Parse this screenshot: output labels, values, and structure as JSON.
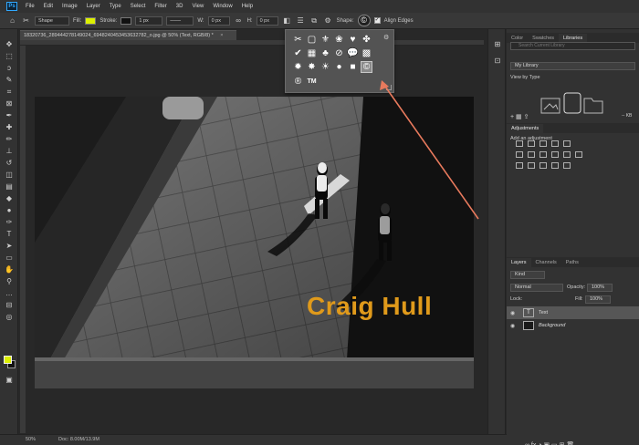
{
  "menu": {
    "items": [
      "File",
      "Edit",
      "Image",
      "Layer",
      "Type",
      "Select",
      "Filter",
      "3D",
      "View",
      "Window",
      "Help"
    ]
  },
  "options_bar": {
    "mode": "Shape",
    "fill_label": "Fill:",
    "stroke_label": "Stroke:",
    "stroke_width": "1 px",
    "w_label": "W:",
    "w_value": "0 px",
    "h_label": "H:",
    "h_value": "0 px",
    "shape_label": "Shape:",
    "align_edges": "Align Edges",
    "colors": {
      "fill": "#ddf000",
      "stroke": "#111111"
    }
  },
  "document": {
    "tab_title": "18320736_289444278149024_6948240453453632782_o.jpg @ 50% (Text, RGB/8) *",
    "overlay_text": "Craig Hull",
    "overlay_color": "#e09a1b"
  },
  "shape_picker": {
    "shapes": [
      "scissors",
      "square-frame",
      "fleur",
      "paw-print",
      "heart",
      "puzzle",
      "checkmark",
      "grid",
      "clubs",
      "no-symbol",
      "speech-bubble",
      "checker",
      "star-burst",
      "splat",
      "sun",
      "circle",
      "square",
      "copyright"
    ],
    "text_shapes": [
      "®",
      "TM"
    ],
    "selected": "copyright"
  },
  "status": {
    "zoom": "50%",
    "doc_size": "Doc: 8.00M/13.9M"
  },
  "libraries_panel": {
    "tabs": [
      "Color",
      "Swatches",
      "Libraries"
    ],
    "active_tab": "Libraries",
    "search_placeholder": "Search Current Library",
    "library": "My Library",
    "view_by": "View by Type",
    "size": "-- KB"
  },
  "adjustments_panel": {
    "title": "Adjustments",
    "subtitle": "Add an adjustment"
  },
  "layers_panel": {
    "tabs": [
      "Layers",
      "Channels",
      "Paths"
    ],
    "active_tab": "Layers",
    "filter": "Kind",
    "blend_mode": "Normal",
    "opacity_label": "Opacity:",
    "opacity": "100%",
    "lock_label": "Lock:",
    "fill_label": "Fill:",
    "fill": "100%",
    "layers": [
      {
        "name": "Text",
        "selected": true,
        "italic": false
      },
      {
        "name": "Background",
        "selected": false,
        "italic": true
      }
    ]
  }
}
